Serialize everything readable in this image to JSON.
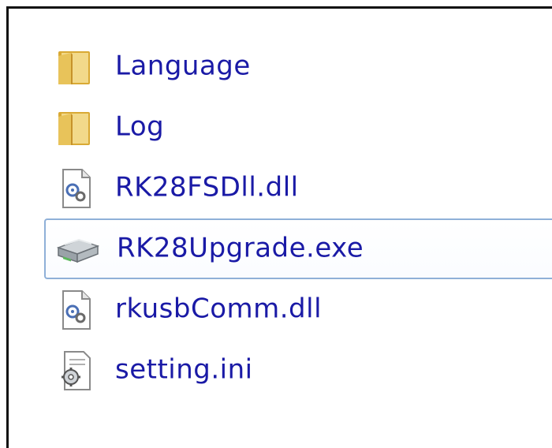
{
  "files": [
    {
      "name": "Language",
      "icon": "folder-icon"
    },
    {
      "name": "Log",
      "icon": "folder-icon"
    },
    {
      "name": "RK28FSDll.dll",
      "icon": "dll-file-icon"
    },
    {
      "name": "RK28Upgrade.exe",
      "icon": "executable-icon",
      "selected": true
    },
    {
      "name": "rkusbComm.dll",
      "icon": "dll-file-icon"
    },
    {
      "name": "setting.ini",
      "icon": "settings-file-icon"
    }
  ],
  "colors": {
    "label": "#1a1aa6",
    "selection_border": "#8fb0d8",
    "folder": "#e8c35a",
    "frame": "#111111"
  }
}
